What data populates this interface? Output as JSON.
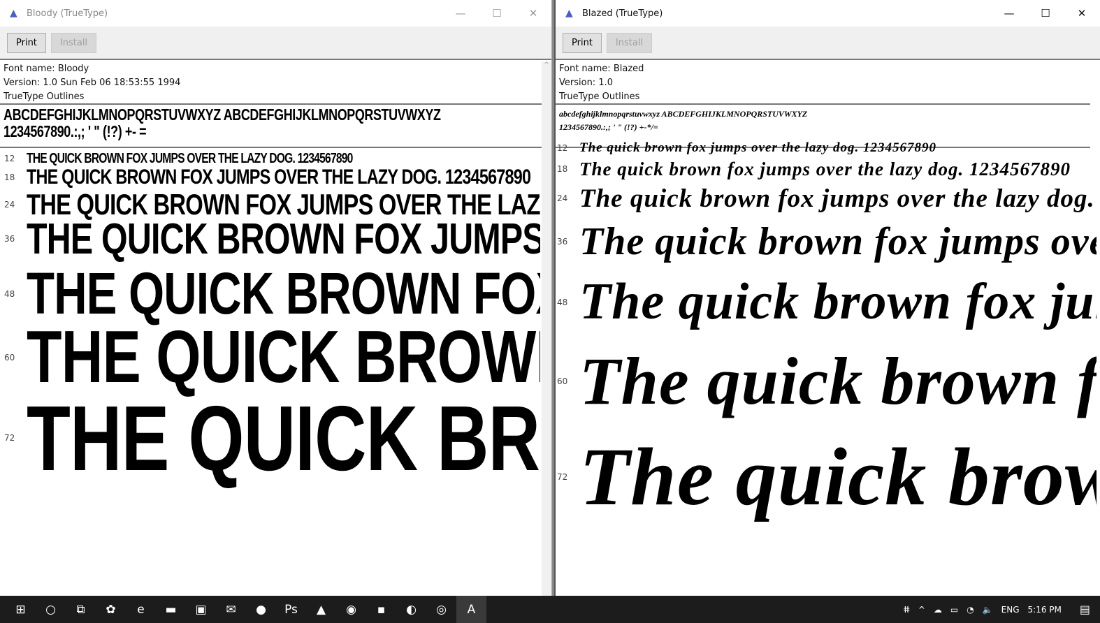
{
  "windows": [
    {
      "title": "Bloody (TrueType)",
      "print": "Print",
      "install": "Install",
      "info": [
        "Font name: Bloody",
        "Version: 1.0 Sun Feb 06 18:53:55 1994",
        "TrueType Outlines"
      ],
      "chars": [
        "ABCDEFGHIJKLMNOPQRSTUVWXYZ  ABCDEFGHIJKLMNOPQRSTUVWXYZ",
        "1234567890.:,; ' \" (!?) +- ="
      ],
      "sample": "THE QUICK BROWN FOX JUMPS OVER THE LAZY DOG. 1234567890",
      "sizes": [
        "12",
        "18",
        "24",
        "36",
        "48",
        "60",
        "72"
      ]
    },
    {
      "title": "Blazed (TrueType)",
      "print": "Print",
      "install": "Install",
      "info": [
        "Font name: Blazed",
        "Version: 1.0",
        "TrueType Outlines"
      ],
      "chars": [
        "abcdefghijklmnopqrstuvwxyz ABCDEFGHIJKLMNOPQRSTUVWXYZ",
        "1234567890.:,; ' \" (!?) +-*/="
      ],
      "sample": "The quick brown fox jumps over the lazy dog. 1234567890",
      "sizes": [
        "12",
        "18",
        "24",
        "36",
        "48",
        "60",
        "72"
      ]
    }
  ],
  "window_controls": {
    "minimize": "—",
    "maximize": "☐",
    "close": "✕"
  },
  "taskbar": {
    "icons": [
      {
        "name": "start",
        "glyph": "⊞"
      },
      {
        "name": "search",
        "glyph": "○"
      },
      {
        "name": "task-view",
        "glyph": "⧉"
      },
      {
        "name": "app-green",
        "glyph": "✿"
      },
      {
        "name": "edge",
        "glyph": "e"
      },
      {
        "name": "file-explorer",
        "glyph": "▬"
      },
      {
        "name": "store",
        "glyph": "▣"
      },
      {
        "name": "mail",
        "glyph": "✉"
      },
      {
        "name": "app-pink",
        "glyph": "●"
      },
      {
        "name": "photoshop",
        "glyph": "Ps"
      },
      {
        "name": "vlc",
        "glyph": "▲"
      },
      {
        "name": "chrome",
        "glyph": "◉"
      },
      {
        "name": "sticky-notes",
        "glyph": "▪"
      },
      {
        "name": "app-globe",
        "glyph": "◐"
      },
      {
        "name": "app-green-circle",
        "glyph": "◎"
      },
      {
        "name": "font-viewer",
        "glyph": "A"
      }
    ],
    "tray": {
      "people": "ⵌ",
      "chevron": "^",
      "cloud": "☁",
      "battery": "▭",
      "wifi": "◔",
      "volume": "🔈",
      "language": "ENG",
      "time": "5:16 PM",
      "notifications": "▤"
    }
  }
}
